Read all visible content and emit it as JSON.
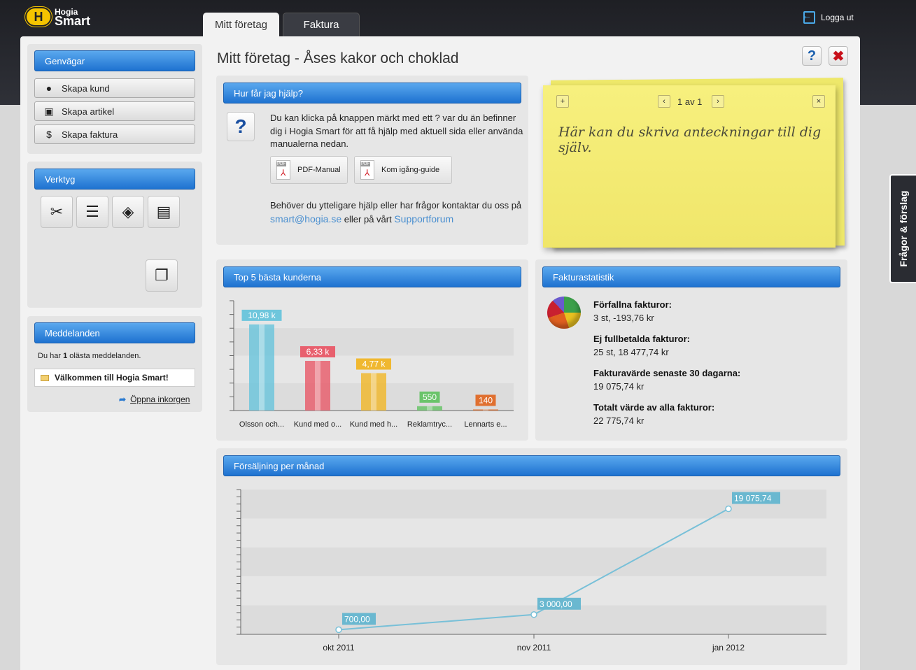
{
  "header": {
    "logo_line1": "Hogia",
    "logo_line2": "Smart",
    "logout_label": "Logga ut",
    "tabs": [
      {
        "label": "Mitt företag",
        "active": true
      },
      {
        "label": "Faktura",
        "active": false
      }
    ]
  },
  "sidebar": {
    "shortcuts": {
      "title": "Genvägar",
      "items": [
        {
          "label": "Skapa kund",
          "icon": "person-icon"
        },
        {
          "label": "Skapa artikel",
          "icon": "box-icon"
        },
        {
          "label": "Skapa faktura",
          "icon": "invoice-icon"
        }
      ]
    },
    "tools": {
      "title": "Verktyg",
      "icons": [
        "tools-icon",
        "contact-card-icon",
        "boxes-icon",
        "documents-icon",
        "windows-icon"
      ]
    },
    "messages": {
      "title": "Meddelanden",
      "unread_prefix": "Du har",
      "unread_count": "1",
      "unread_suffix": "olästa meddelanden.",
      "message": "Välkommen till Hogia Smart!",
      "open_inbox": "Öppna inkorgen"
    }
  },
  "main": {
    "title": "Mitt företag - Åses kakor och choklad",
    "help_panel": {
      "title": "Hur får jag hjälp?",
      "text": "Du kan klicka på knappen märkt med ett ? var du än befinner dig i Hogia Smart för att få hjälp med aktuell sida eller använda manualerna nedan.",
      "pdf_manual": "PDF-Manual",
      "guide": "Kom igång-guide",
      "more_text": "Behöver du ytteligare hjälp eller har frågor kontaktar du oss på",
      "email": "smart@hogia.se",
      "or_text": "eller på vårt",
      "forum": "Supportforum"
    },
    "note": {
      "page": "1 av 1",
      "text": "Här kan du skriva anteckningar till dig själv."
    },
    "top5": {
      "title": "Top 5 bästa kunderna"
    },
    "invoice_stats": {
      "title": "Fakturastatistik",
      "items": [
        {
          "label": "Förfallna fakturor:",
          "value": "3 st, -193,76 kr"
        },
        {
          "label": "Ej fullbetalda fakturor:",
          "value": "25 st, 18 477,74 kr"
        },
        {
          "label": "Fakturavärde senaste 30 dagarna:",
          "value": "19 075,74 kr"
        },
        {
          "label": "Totalt värde av alla fakturor:",
          "value": "22 775,74 kr"
        }
      ]
    },
    "sales": {
      "title": "Försäljning per månad"
    }
  },
  "side_tab": "Frågor & förslag",
  "colors": {
    "accent_blue": "#1e72d0",
    "note_yellow": "#f4ec78",
    "line_color": "#78c0d8"
  },
  "chart_data": [
    {
      "type": "bar",
      "title": "Top 5 bästa kunderna",
      "categories": [
        "Olsson och...",
        "Kund med o...",
        "Kund med h...",
        "Reklamtryc...",
        "Lennarts e..."
      ],
      "values": [
        10980,
        6330,
        4770,
        550,
        140
      ],
      "labels": [
        "10,98 k",
        "6,33 k",
        "4,77 k",
        "550",
        "140"
      ],
      "colors": [
        "#6ec6dc",
        "#e8606e",
        "#f0b830",
        "#6ac46a",
        "#e07030"
      ],
      "ylim": [
        0,
        14000
      ],
      "grid": true
    },
    {
      "type": "line",
      "title": "Försäljning per månad",
      "x": [
        "okt 2011",
        "nov 2011",
        "jan 2012"
      ],
      "x_pos": [
        0,
        1,
        2
      ],
      "y": [
        700,
        3000,
        19075.74
      ],
      "labels": [
        "700,00",
        "3 000,00",
        "19 075,74"
      ],
      "ylim": [
        0,
        22000
      ],
      "grid": true
    }
  ]
}
